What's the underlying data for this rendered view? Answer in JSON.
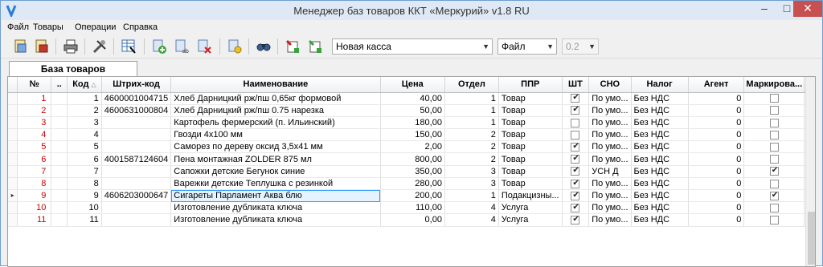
{
  "window": {
    "title": "Менеджер баз товаров ККТ «Меркурий» v1.8 RU",
    "min": "–",
    "max": "□",
    "close": "✕"
  },
  "menu": [
    "Файл",
    "Товары",
    "Операции",
    "Справка"
  ],
  "toolbar": {
    "icons": [
      "open-db-icon",
      "save-db-icon",
      "print-icon",
      "tools-icon",
      "grid-settings-icon",
      "add-item-icon",
      "edit-item-icon",
      "delete-item-icon",
      "settings-icon",
      "find-icon",
      "export-icon",
      "import-icon"
    ],
    "device_select": "Новая касса",
    "source_select": "Файл",
    "version_select": "0.2"
  },
  "tab": {
    "label": "База товаров"
  },
  "grid": {
    "columns": [
      "№",
      "..",
      "Код",
      "Штрих-код",
      "Наименование",
      "Цена",
      "Отдел",
      "ППР",
      "ШТ",
      "СНО",
      "Налог",
      "Агент",
      "Маркирова..."
    ],
    "sort_indicator": "△",
    "current_row_marker": "▸",
    "rows": [
      {
        "n": "1",
        "code": "1",
        "barcode": "4600001004715",
        "name": "Хлеб Дарницкий рж/пш 0,65кг формовой",
        "price": "40,00",
        "dept": "1",
        "ppr": "Товар",
        "sht": true,
        "sno": "По умо...",
        "tax": "Без НДС",
        "agent": "0",
        "mark": false
      },
      {
        "n": "2",
        "code": "2",
        "barcode": "4600631000804",
        "name": "Хлеб Дарницкий рж/пш 0.75 нарезка",
        "price": "50,00",
        "dept": "1",
        "ppr": "Товар",
        "sht": true,
        "sno": "По умо...",
        "tax": "Без НДС",
        "agent": "0",
        "mark": false
      },
      {
        "n": "3",
        "code": "3",
        "barcode": "",
        "name": "Картофель фермерский (п. Ильинский)",
        "price": "180,00",
        "dept": "1",
        "ppr": "Товар",
        "sht": false,
        "sno": "По умо...",
        "tax": "Без НДС",
        "agent": "0",
        "mark": false
      },
      {
        "n": "4",
        "code": "4",
        "barcode": "",
        "name": "Гвозди 4х100 мм",
        "price": "150,00",
        "dept": "2",
        "ppr": "Товар",
        "sht": false,
        "sno": "По умо...",
        "tax": "Без НДС",
        "agent": "0",
        "mark": false
      },
      {
        "n": "5",
        "code": "5",
        "barcode": "",
        "name": "Саморез по дереву оксид 3,5х41 мм",
        "price": "2,00",
        "dept": "2",
        "ppr": "Товар",
        "sht": true,
        "sno": "По умо...",
        "tax": "Без НДС",
        "agent": "0",
        "mark": false
      },
      {
        "n": "6",
        "code": "6",
        "barcode": "4001587124604",
        "name": "Пена монтажная ZOLDER 875 мл",
        "price": "800,00",
        "dept": "2",
        "ppr": "Товар",
        "sht": true,
        "sno": "По умо...",
        "tax": "Без НДС",
        "agent": "0",
        "mark": false
      },
      {
        "n": "7",
        "code": "7",
        "barcode": "",
        "name": "Сапожки детские Бегунок синие",
        "price": "350,00",
        "dept": "3",
        "ppr": "Товар",
        "sht": true,
        "sno": "УСН Д",
        "tax": "Без НДС",
        "agent": "0",
        "mark": true
      },
      {
        "n": "8",
        "code": "8",
        "barcode": "",
        "name": "Варежки детские Теплушка с резинкой",
        "price": "280,00",
        "dept": "3",
        "ppr": "Товар",
        "sht": true,
        "sno": "По умо...",
        "tax": "Без НДС",
        "agent": "0",
        "mark": false
      },
      {
        "n": "9",
        "code": "9",
        "barcode": "4606203000647",
        "name": "Сигареты Парламент Аква блю",
        "price": "200,00",
        "dept": "1",
        "ppr": "Подакцизны...",
        "sht": true,
        "sno": "По умо...",
        "tax": "Без НДС",
        "agent": "0",
        "mark": true
      },
      {
        "n": "10",
        "code": "10",
        "barcode": "",
        "name": "Изготовление дубликата ключа",
        "price": "110,00",
        "dept": "4",
        "ppr": "Услуга",
        "sht": true,
        "sno": "По умо...",
        "tax": "Без НДС",
        "agent": "0",
        "mark": false
      },
      {
        "n": "11",
        "code": "11",
        "barcode": "",
        "name": "Изготовление дубликата ключа",
        "price": "0,00",
        "dept": "4",
        "ppr": "Услуга",
        "sht": true,
        "sno": "По умо...",
        "tax": "Без НДС",
        "agent": "0",
        "mark": false
      }
    ],
    "selected_row": 8
  }
}
